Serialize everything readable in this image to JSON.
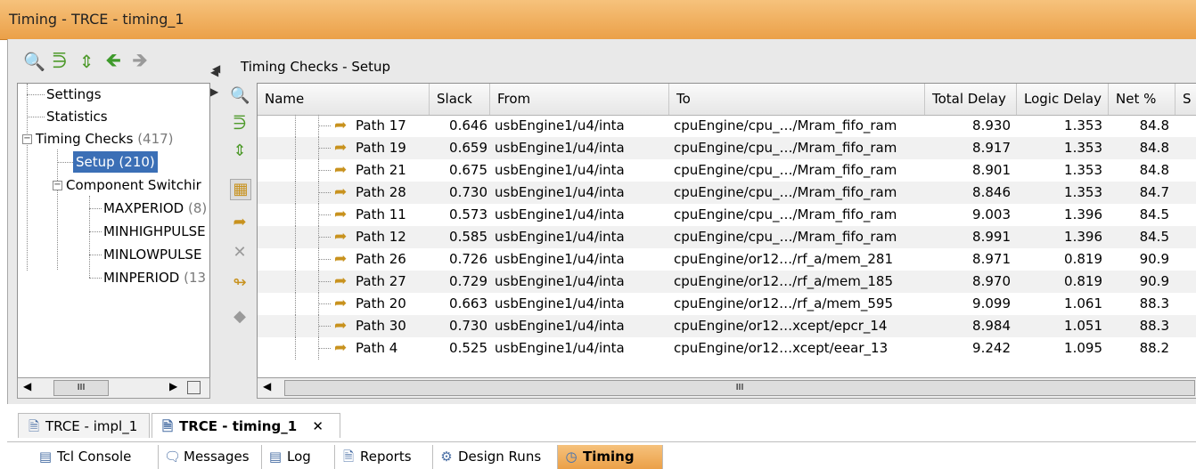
{
  "window": {
    "title": "Timing - TRCE - timing_1"
  },
  "left_toolbar": {
    "icons": [
      "search-icon",
      "expand-all-icon",
      "collapse-all-icon",
      "back-icon",
      "forward-icon"
    ]
  },
  "tree": {
    "settings": "Settings",
    "statistics": "Statistics",
    "timing_checks": "Timing Checks",
    "timing_checks_count": "(417)",
    "setup": "Setup (210)",
    "component_switching": "Component Switchir",
    "maxperiod": "MAXPERIOD",
    "maxperiod_count": "(8)",
    "minhighpulse": "MINHIGHPULSE",
    "minlowpulse": "MINLOWPULSE",
    "minperiod": "MINPERIOD",
    "minperiod_count": "(13"
  },
  "right": {
    "header": "Timing Checks - Setup"
  },
  "columns": {
    "name": "Name",
    "slack": "Slack",
    "from": "From",
    "to": "To",
    "total_delay": "Total Delay",
    "logic_delay": "Logic Delay",
    "net_pct": "Net %",
    "extra": "S"
  },
  "rows": [
    {
      "name": "Path 17",
      "slack": "0.646",
      "from": "usbEngine1/u4/inta",
      "to": "cpuEngine/cpu_…/Mram_fifo_ram",
      "total": "8.930",
      "logic": "1.353",
      "net": "84.8"
    },
    {
      "name": "Path 19",
      "slack": "0.659",
      "from": "usbEngine1/u4/inta",
      "to": "cpuEngine/cpu_…/Mram_fifo_ram",
      "total": "8.917",
      "logic": "1.353",
      "net": "84.8"
    },
    {
      "name": "Path 21",
      "slack": "0.675",
      "from": "usbEngine1/u4/inta",
      "to": "cpuEngine/cpu_…/Mram_fifo_ram",
      "total": "8.901",
      "logic": "1.353",
      "net": "84.8"
    },
    {
      "name": "Path 28",
      "slack": "0.730",
      "from": "usbEngine1/u4/inta",
      "to": "cpuEngine/cpu_…/Mram_fifo_ram",
      "total": "8.846",
      "logic": "1.353",
      "net": "84.7"
    },
    {
      "name": "Path 11",
      "slack": "0.573",
      "from": "usbEngine1/u4/inta",
      "to": "cpuEngine/cpu_…/Mram_fifo_ram",
      "total": "9.003",
      "logic": "1.396",
      "net": "84.5"
    },
    {
      "name": "Path 12",
      "slack": "0.585",
      "from": "usbEngine1/u4/inta",
      "to": "cpuEngine/cpu_…/Mram_fifo_ram",
      "total": "8.991",
      "logic": "1.396",
      "net": "84.5"
    },
    {
      "name": "Path 26",
      "slack": "0.726",
      "from": "usbEngine1/u4/inta",
      "to": "cpuEngine/or12…/rf_a/mem_281",
      "total": "8.971",
      "logic": "0.819",
      "net": "90.9"
    },
    {
      "name": "Path 27",
      "slack": "0.729",
      "from": "usbEngine1/u4/inta",
      "to": "cpuEngine/or12…/rf_a/mem_185",
      "total": "8.970",
      "logic": "0.819",
      "net": "90.9"
    },
    {
      "name": "Path 20",
      "slack": "0.663",
      "from": "usbEngine1/u4/inta",
      "to": "cpuEngine/or12…/rf_a/mem_595",
      "total": "9.099",
      "logic": "1.061",
      "net": "88.3"
    },
    {
      "name": "Path 30",
      "slack": "0.730",
      "from": "usbEngine1/u4/inta",
      "to": "cpuEngine/or12…xcept/epcr_14",
      "total": "8.984",
      "logic": "1.051",
      "net": "88.3"
    },
    {
      "name": "Path 4",
      "slack": "0.525",
      "from": "usbEngine1/u4/inta",
      "to": "cpuEngine/or12…xcept/eear_13",
      "total": "9.242",
      "logic": "1.095",
      "net": "88.2"
    }
  ],
  "doc_tabs": {
    "impl": "TRCE - impl_1",
    "timing": "TRCE - timing_1",
    "close": "✕"
  },
  "bottom_tabs": {
    "tcl": "Tcl Console",
    "messages": "Messages",
    "log": "Log",
    "reports": "Reports",
    "design_runs": "Design Runs",
    "timing": "Timing"
  },
  "scroll": {
    "grip": "III"
  },
  "colors": {
    "accent": "#eba048",
    "selection": "#3b6fb6"
  }
}
